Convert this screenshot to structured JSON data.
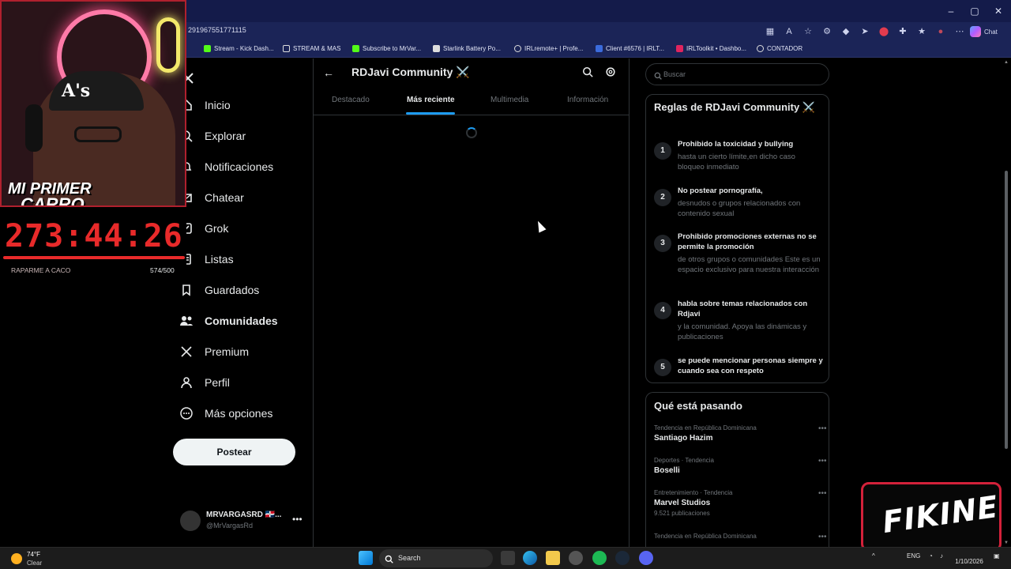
{
  "browser": {
    "url": "291967551771115",
    "chat_label": "Chat",
    "bookmarks": [
      {
        "label": "Stream - Kick Dash..."
      },
      {
        "label": "STREAM & MAS"
      },
      {
        "label": "Subscribe to MrVar..."
      },
      {
        "label": "Starlink Battery Po..."
      },
      {
        "label": "IRLremote+ | Profe..."
      },
      {
        "label": "Client #6576 | IRLT..."
      },
      {
        "label": "IRLToolkit • Dashbo..."
      },
      {
        "label": "CONTADOR"
      }
    ]
  },
  "nav": {
    "items": [
      {
        "label": "Inicio",
        "icon": "home-icon"
      },
      {
        "label": "Explorar",
        "icon": "search-icon"
      },
      {
        "label": "Notificaciones",
        "icon": "bell-icon"
      },
      {
        "label": "Chatear",
        "icon": "mail-icon"
      },
      {
        "label": "Grok",
        "icon": "grok-icon"
      },
      {
        "label": "Listas",
        "icon": "list-icon"
      },
      {
        "label": "Guardados",
        "icon": "bookmark-icon"
      },
      {
        "label": "Comunidades",
        "icon": "communities-icon"
      },
      {
        "label": "Premium",
        "icon": "x-logo-icon"
      },
      {
        "label": "Perfil",
        "icon": "person-icon"
      },
      {
        "label": "Más opciones",
        "icon": "more-circle-icon"
      }
    ],
    "post_label": "Postear",
    "account": {
      "name": "MRVARGASRD 🇩🇴...",
      "handle": "@MrVargasRd"
    }
  },
  "community": {
    "title": "RDJavi Community ⚔️",
    "tabs": [
      "Destacado",
      "Más reciente",
      "Multimedia",
      "Información"
    ],
    "active_tab": "Más reciente"
  },
  "sidebar": {
    "search_placeholder": "Buscar",
    "rules_title": "Reglas de RDJavi Community ⚔️",
    "rules": [
      {
        "num": "1",
        "title": "Prohibido la toxicidad y bullying",
        "desc": "hasta un cierto límite,en dicho caso bloqueo inmediato"
      },
      {
        "num": "2",
        "title": "No postear pornografía,",
        "desc": "desnudos o grupos relacionados con contenido sexual"
      },
      {
        "num": "3",
        "title": "Prohibido promociones externas no se permite la promoción",
        "desc": "de otros grupos o comunidades Este es un espacio exclusivo para nuestra interacción"
      },
      {
        "num": "4",
        "title": "habla sobre temas relacionados con Rdjavi",
        "desc": "y la comunidad. Apoya las dinámicas y publicaciones"
      },
      {
        "num": "5",
        "title": "se puede mencionar personas siempre y cuando sea con respeto",
        "desc": ""
      }
    ],
    "trends_title": "Qué está pasando",
    "trends": [
      {
        "context": "Tendencia en República Dominicana",
        "name": "Santiago Hazim",
        "count": ""
      },
      {
        "context": "Deportes · Tendencia",
        "name": "Boselli",
        "count": ""
      },
      {
        "context": "Entretenimiento · Tendencia",
        "name": "Marvel Studios",
        "count": "9.521 publicaciones"
      },
      {
        "context": "Tendencia en República Dominicana",
        "name": "",
        "count": ""
      }
    ]
  },
  "overlay": {
    "cam_text_1": "MI PRIMER",
    "cam_text_2": "CARRO",
    "cap_text": "A's",
    "timer": "273:44:26",
    "timer_label": "RAPARME A CACO",
    "timer_count": "574/500",
    "brand": "FIKINE"
  },
  "taskbar": {
    "weather_temp": "74°F",
    "weather_desc": "Clear",
    "search_label": "Search",
    "lang": "ENG",
    "date": "1/10/2026"
  },
  "colors": {
    "accent": "#1d9bf0",
    "browser_bar": "#1b2457",
    "timer_red": "#e82a2a"
  }
}
